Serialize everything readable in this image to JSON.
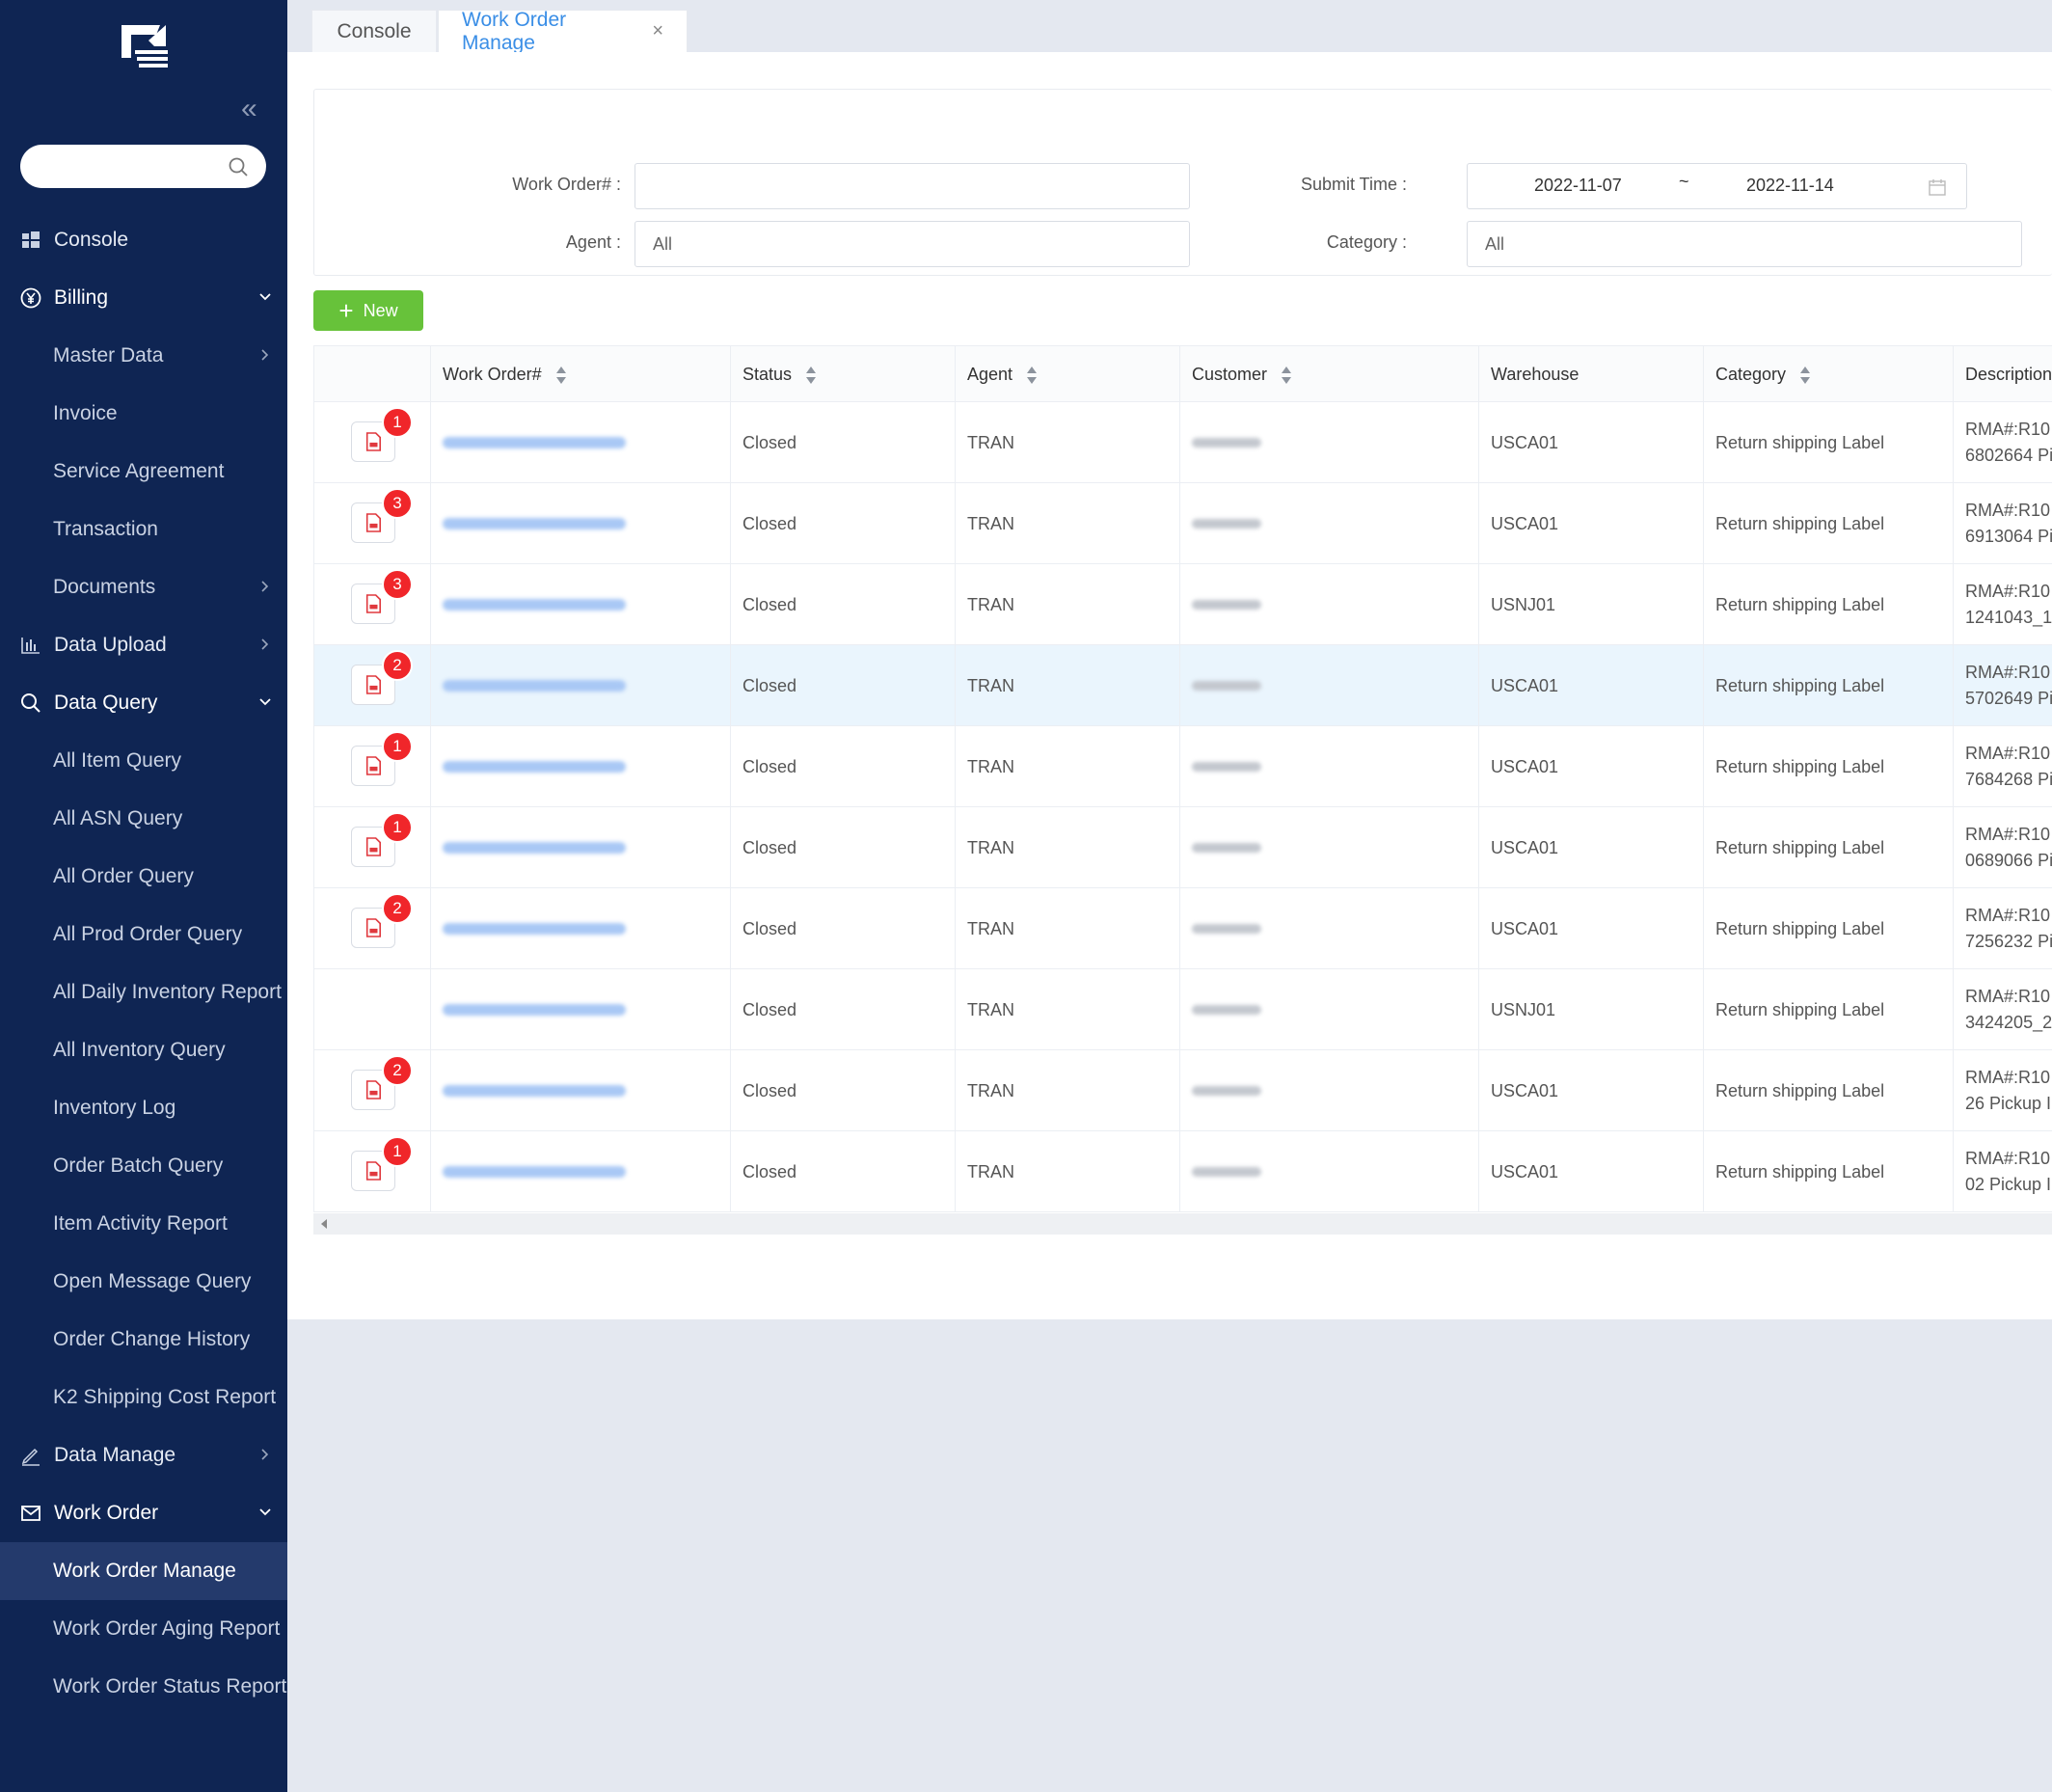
{
  "sidebar": {
    "search_placeholder": "",
    "items": [
      {
        "label": "Console",
        "level": "top",
        "icon": "dashboard-icon"
      },
      {
        "label": "Billing",
        "level": "top",
        "icon": "yen-icon",
        "expanded": true
      },
      {
        "label": "Master Data",
        "level": "sub",
        "arrow": "right"
      },
      {
        "label": "Invoice",
        "level": "sub"
      },
      {
        "label": "Service Agreement",
        "level": "sub"
      },
      {
        "label": "Transaction",
        "level": "sub"
      },
      {
        "label": "Documents",
        "level": "sub",
        "arrow": "right"
      },
      {
        "label": "Data Upload",
        "level": "top",
        "icon": "bar-chart-icon",
        "arrow": "right"
      },
      {
        "label": "Data Query",
        "level": "top",
        "icon": "search-icon",
        "expanded": true
      },
      {
        "label": "All Item Query",
        "level": "sub"
      },
      {
        "label": "All ASN Query",
        "level": "sub"
      },
      {
        "label": "All Order Query",
        "level": "sub"
      },
      {
        "label": "All Prod Order Query",
        "level": "sub"
      },
      {
        "label": "All Daily Inventory Report",
        "level": "sub"
      },
      {
        "label": "All Inventory Query",
        "level": "sub"
      },
      {
        "label": "Inventory Log",
        "level": "sub"
      },
      {
        "label": "Order Batch Query",
        "level": "sub"
      },
      {
        "label": "Item Activity Report",
        "level": "sub"
      },
      {
        "label": "Open Message Query",
        "level": "sub"
      },
      {
        "label": "Order Change History",
        "level": "sub"
      },
      {
        "label": "K2 Shipping Cost Report",
        "level": "sub"
      },
      {
        "label": "Data Manage",
        "level": "top",
        "icon": "edit-icon",
        "arrow": "right"
      },
      {
        "label": "Work Order",
        "level": "top",
        "icon": "mail-icon",
        "expanded": true
      },
      {
        "label": "Work Order Manage",
        "level": "sub",
        "active": true
      },
      {
        "label": "Work Order Aging Report",
        "level": "sub"
      },
      {
        "label": "Work Order Status Report",
        "level": "sub"
      }
    ]
  },
  "tabs": {
    "console": "Console",
    "active": "Work Order Manage",
    "close_glyph": "×"
  },
  "filters": {
    "work_order_label": "Work Order#",
    "work_order_value": "",
    "agent_label": "Agent",
    "agent_value": "All",
    "submit_time_label": "Submit Time",
    "date_start": "2022-11-07",
    "date_sep": "~",
    "date_end": "2022-11-14",
    "category_label": "Category",
    "category_value": "All",
    "colon": ":"
  },
  "new_button": {
    "label": "New",
    "plus": "+"
  },
  "table": {
    "columns": [
      "Work Order#",
      "Status",
      "Agent",
      "Customer",
      "Warehouse",
      "Category",
      "Description"
    ],
    "rows": [
      {
        "badge": "1",
        "status": "Closed",
        "agent": "TRAN",
        "warehouse": "USCA01",
        "category": "Return shipping Label",
        "desc1": "RMA#:R10",
        "desc2": "6802664 Pi"
      },
      {
        "badge": "3",
        "status": "Closed",
        "agent": "TRAN",
        "warehouse": "USCA01",
        "category": "Return shipping Label",
        "desc1": "RMA#:R10",
        "desc2": "6913064 Pi"
      },
      {
        "badge": "3",
        "status": "Closed",
        "agent": "TRAN",
        "warehouse": "USNJ01",
        "category": "Return shipping Label",
        "desc1": "RMA#:R10",
        "desc2": "1241043_1"
      },
      {
        "badge": "2",
        "status": "Closed",
        "agent": "TRAN",
        "warehouse": "USCA01",
        "category": "Return shipping Label",
        "desc1": "RMA#:R10",
        "desc2": "5702649 Pi",
        "highlight": true
      },
      {
        "badge": "1",
        "status": "Closed",
        "agent": "TRAN",
        "warehouse": "USCA01",
        "category": "Return shipping Label",
        "desc1": "RMA#:R10",
        "desc2": "7684268 Pi"
      },
      {
        "badge": "1",
        "status": "Closed",
        "agent": "TRAN",
        "warehouse": "USCA01",
        "category": "Return shipping Label",
        "desc1": "RMA#:R10",
        "desc2": "0689066 Pi"
      },
      {
        "badge": "2",
        "status": "Closed",
        "agent": "TRAN",
        "warehouse": "USCA01",
        "category": "Return shipping Label",
        "desc1": "RMA#:R10",
        "desc2": "7256232 Pi"
      },
      {
        "badge": "",
        "status": "Closed",
        "agent": "TRAN",
        "warehouse": "USNJ01",
        "category": "Return shipping Label",
        "desc1": "RMA#:R10",
        "desc2": "3424205_2"
      },
      {
        "badge": "2",
        "status": "Closed",
        "agent": "TRAN",
        "warehouse": "USCA01",
        "category": "Return shipping Label",
        "desc1": "RMA#:R10",
        "desc2": "26 Pickup I"
      },
      {
        "badge": "1",
        "status": "Closed",
        "agent": "TRAN",
        "warehouse": "USCA01",
        "category": "Return shipping Label",
        "desc1": "RMA#:R10",
        "desc2": "02 Pickup I"
      }
    ]
  },
  "colors": {
    "sidebar_bg": "#0f2553",
    "accent": "#3a8ee6",
    "new_button": "#67c23a",
    "badge": "#f0262a"
  }
}
